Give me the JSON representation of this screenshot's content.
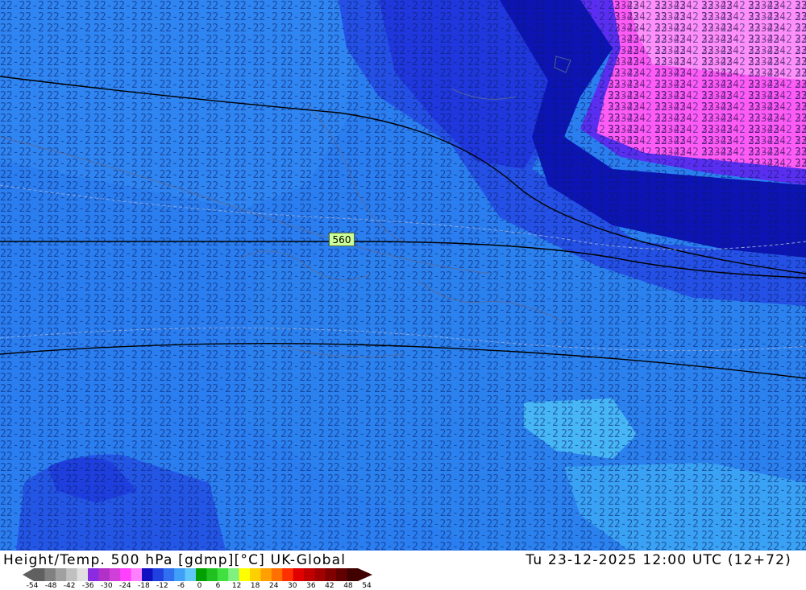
{
  "title": {
    "product": "Height/Temp. 500 hPa [gdmp][°C] UK-Global",
    "valid_time": "Tu 23-12-2025 12:00 UTC (12+72)"
  },
  "contour_label": "560",
  "legend": {
    "ticks": [
      "-54",
      "-48",
      "-42",
      "-36",
      "-30",
      "-24",
      "-18",
      "-12",
      "-6",
      "0",
      "6",
      "12",
      "18",
      "24",
      "30",
      "36",
      "42",
      "48",
      "54"
    ],
    "colors": [
      "#606060",
      "#808080",
      "#a0a0a0",
      "#c0c0c0",
      "#e0e0e0",
      "#8a2be2",
      "#b030c8",
      "#d040d8",
      "#ff40ff",
      "#ff80ff",
      "#1010c0",
      "#2040e0",
      "#3070f0",
      "#40a0f8",
      "#60c8f8",
      "#00a000",
      "#20c020",
      "#40e040",
      "#80f080",
      "#ffff00",
      "#ffd000",
      "#ffa000",
      "#ff7000",
      "#ff3000",
      "#e00000",
      "#c00000",
      "#a00000",
      "#800000",
      "#600000",
      "#400000"
    ]
  },
  "map_colors": {
    "base": "#2a7ef0",
    "light": "#3c98f4",
    "dark_blue": "#1a2de0",
    "deep": "#0c14b4",
    "purple": "#5a2ef0",
    "magenta": "#ff5cf6",
    "pink": "#ff90fa",
    "warm_cyan": "#40c0f8"
  }
}
